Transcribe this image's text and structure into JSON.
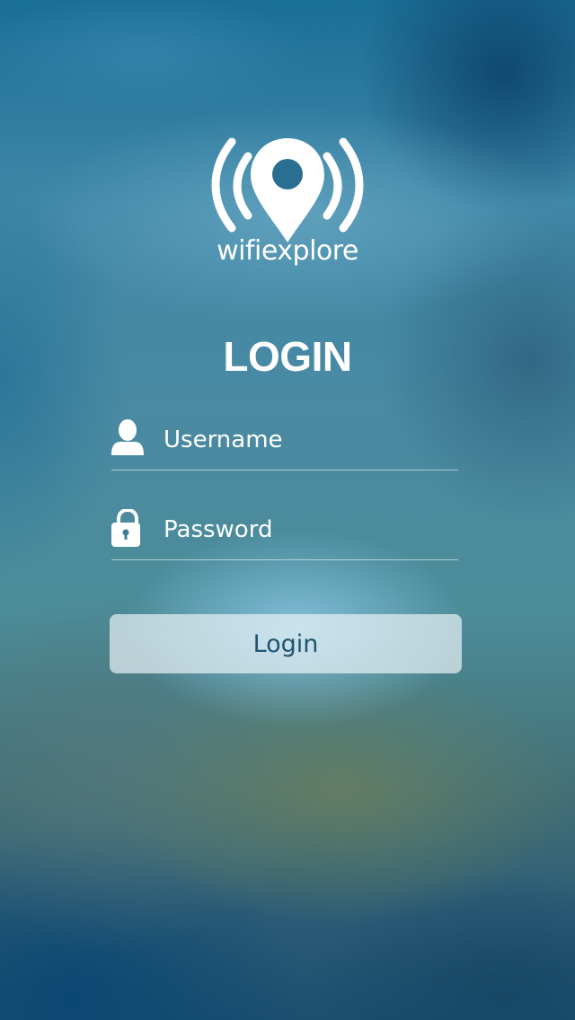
{
  "app": {
    "logo_text": "wifiexplore",
    "logo_icon": "wifi-location-pin-icon"
  },
  "login": {
    "title": "LOGIN",
    "username": {
      "icon": "user-icon",
      "placeholder": "Username",
      "value": ""
    },
    "password": {
      "icon": "lock-icon",
      "placeholder": "Password",
      "value": ""
    },
    "submit_label": "Login"
  },
  "colors": {
    "text": "#ffffff",
    "button_background": "#e4f0f4",
    "button_text": "#1f5470",
    "underline": "#ffffff"
  }
}
